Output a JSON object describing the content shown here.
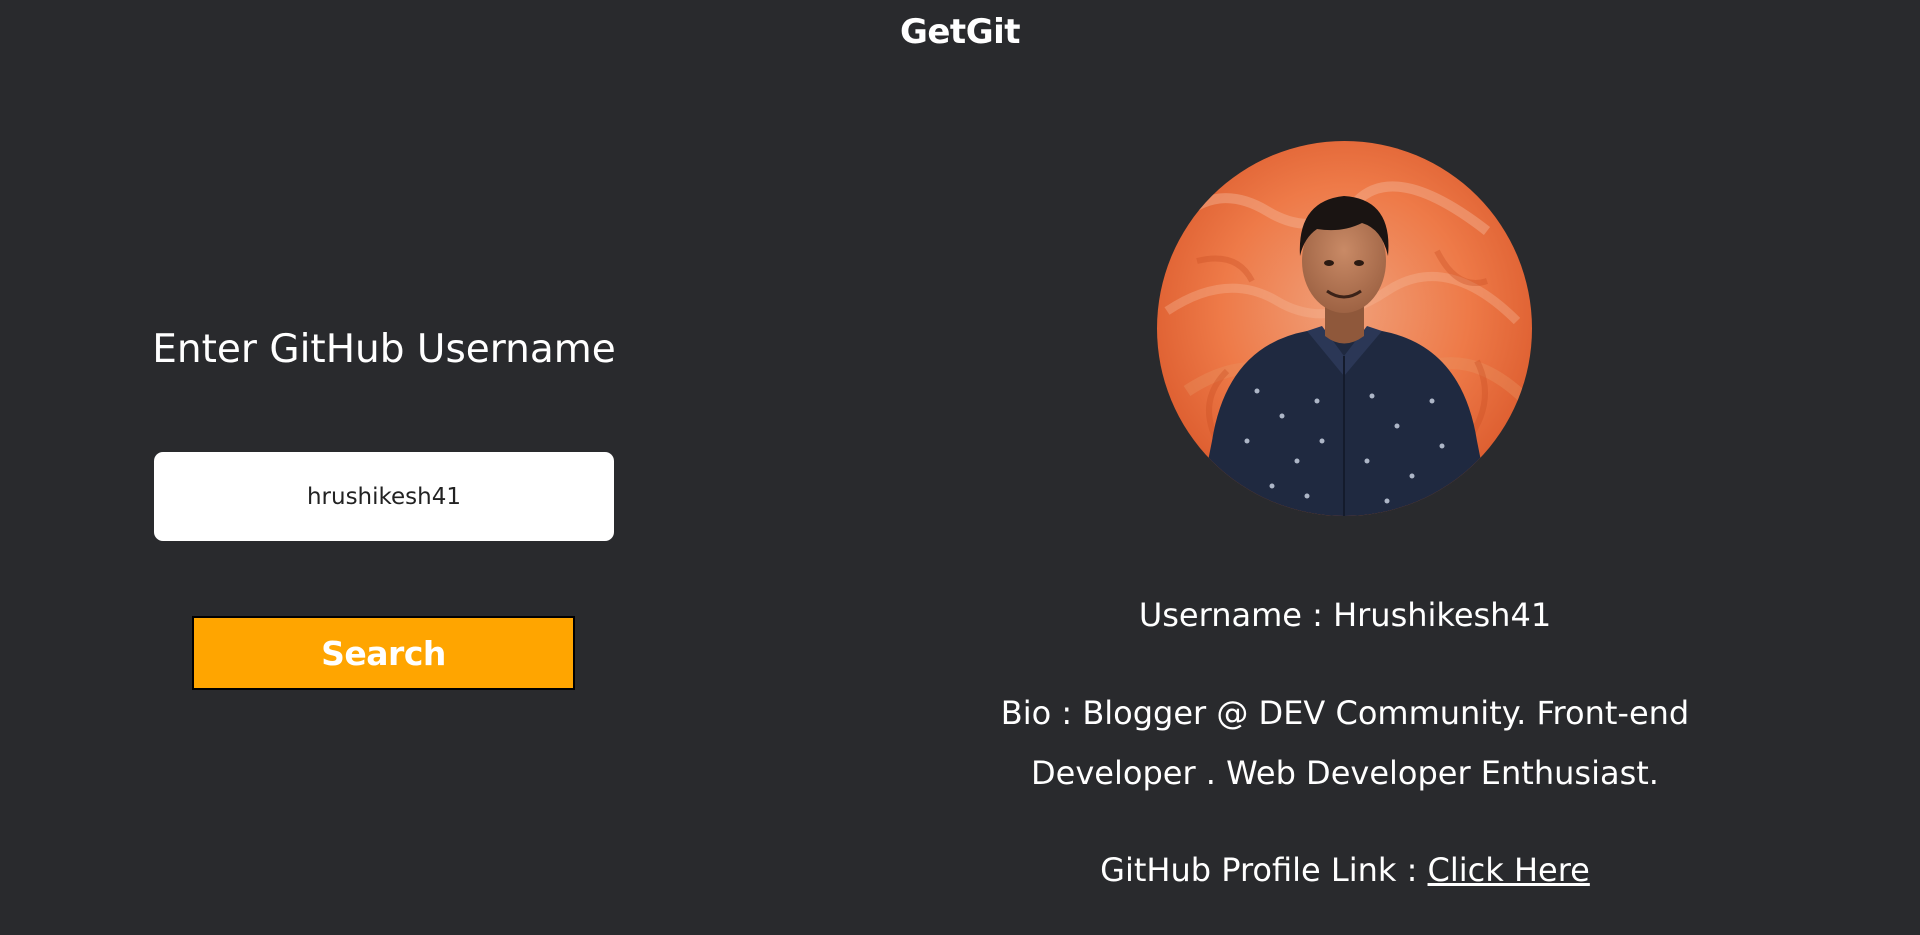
{
  "header": {
    "title": "GetGit"
  },
  "search": {
    "heading": "Enter GitHub Username",
    "input_value": "hrushikesh41",
    "button_label": "Search"
  },
  "profile": {
    "avatar_icon": "user-photo",
    "username_label": "Username : ",
    "username_value": "Hrushikesh41",
    "bio_label": "Bio : ",
    "bio_value": "Blogger @ DEV Community. Front-end Developer . Web Developer Enthusiast.",
    "link_label": "GitHub Profile Link : ",
    "link_text": "Click Here"
  },
  "colors": {
    "background": "#292a2d",
    "text": "#ffffff",
    "accent": "#ffa500",
    "input_background": "#ffffff"
  }
}
